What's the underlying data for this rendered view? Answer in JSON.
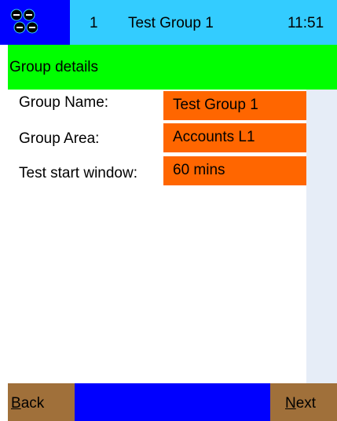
{
  "status_bar": {
    "logo_icon": "phones-logo-icon",
    "number": "1",
    "title": "Test Group 1",
    "time": "11:51"
  },
  "section_header": {
    "title": "Group details"
  },
  "fields": [
    {
      "label": "Group Name:",
      "value": "Test Group 1"
    },
    {
      "label": "Group Area:",
      "value": "Accounts L1"
    },
    {
      "label": "Test start window:",
      "value": "60 mins"
    }
  ],
  "nav": {
    "back_label": "Back",
    "next_label": "Next"
  },
  "colors": {
    "status_bar": "#33ccff",
    "logo_box": "#0000ff",
    "section_header": "#00ff00",
    "field_value": "#ff6600",
    "nav_button": "#a0703a",
    "bottom_bar": "#0000ff"
  }
}
